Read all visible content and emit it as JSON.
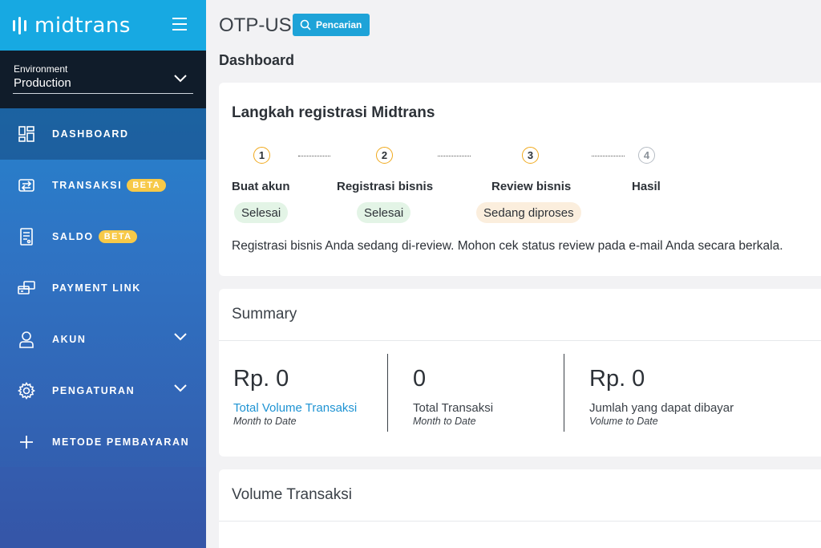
{
  "sidebar": {
    "logo_text": "midtrans",
    "environment": {
      "label": "Environment",
      "value": "Production"
    },
    "items": [
      {
        "label": "DASHBOARD",
        "icon": "dashboard-icon",
        "active": true
      },
      {
        "label": "TRANSAKSI",
        "icon": "transaction-icon",
        "badge": "BETA"
      },
      {
        "label": "SALDO",
        "icon": "balance-icon",
        "badge": "BETA"
      },
      {
        "label": "PAYMENT LINK",
        "icon": "payment-link-icon"
      },
      {
        "label": "AKUN",
        "icon": "user-icon",
        "expandable": true
      },
      {
        "label": "PENGATURAN",
        "icon": "gear-icon",
        "expandable": true
      },
      {
        "label": "METODE PEMBAYARAN",
        "icon": "plus-icon"
      }
    ]
  },
  "header": {
    "merchant": "OTP-US",
    "search_label": "Pencarian",
    "page_title": "Dashboard"
  },
  "registration": {
    "title": "Langkah registrasi Midtrans",
    "steps": [
      {
        "number": "1",
        "label": "Buat akun",
        "status": "Selesai"
      },
      {
        "number": "2",
        "label": "Registrasi bisnis",
        "status": "Selesai"
      },
      {
        "number": "3",
        "label": "Review bisnis",
        "status": "Sedang diproses"
      },
      {
        "number": "4",
        "label": "Hasil",
        "status": ""
      }
    ],
    "note": "Registrasi bisnis Anda sedang di-review. Mohon cek status review pada e-mail Anda secara berkala."
  },
  "summary": {
    "title": "Summary",
    "metrics": [
      {
        "value": "Rp. 0",
        "label": "Total Volume Transaksi",
        "sub": "Month to Date"
      },
      {
        "value": "0",
        "label": "Total Transaksi",
        "sub": "Month to Date"
      },
      {
        "value": "Rp. 0",
        "label": "Jumlah yang dapat dibayar",
        "sub": "Volume to Date"
      }
    ]
  },
  "volume": {
    "title": "Volume Transaksi"
  },
  "colors": {
    "accent": "#1ea3d8",
    "logo_bar": "#17a9e2",
    "env_bg": "#101c2a",
    "badge": "#f7c948",
    "step_ring": "#f0a91c",
    "done_pill": "#e3f4e6",
    "progress_pill": "#fbeedd",
    "link": "#1e93d3"
  }
}
